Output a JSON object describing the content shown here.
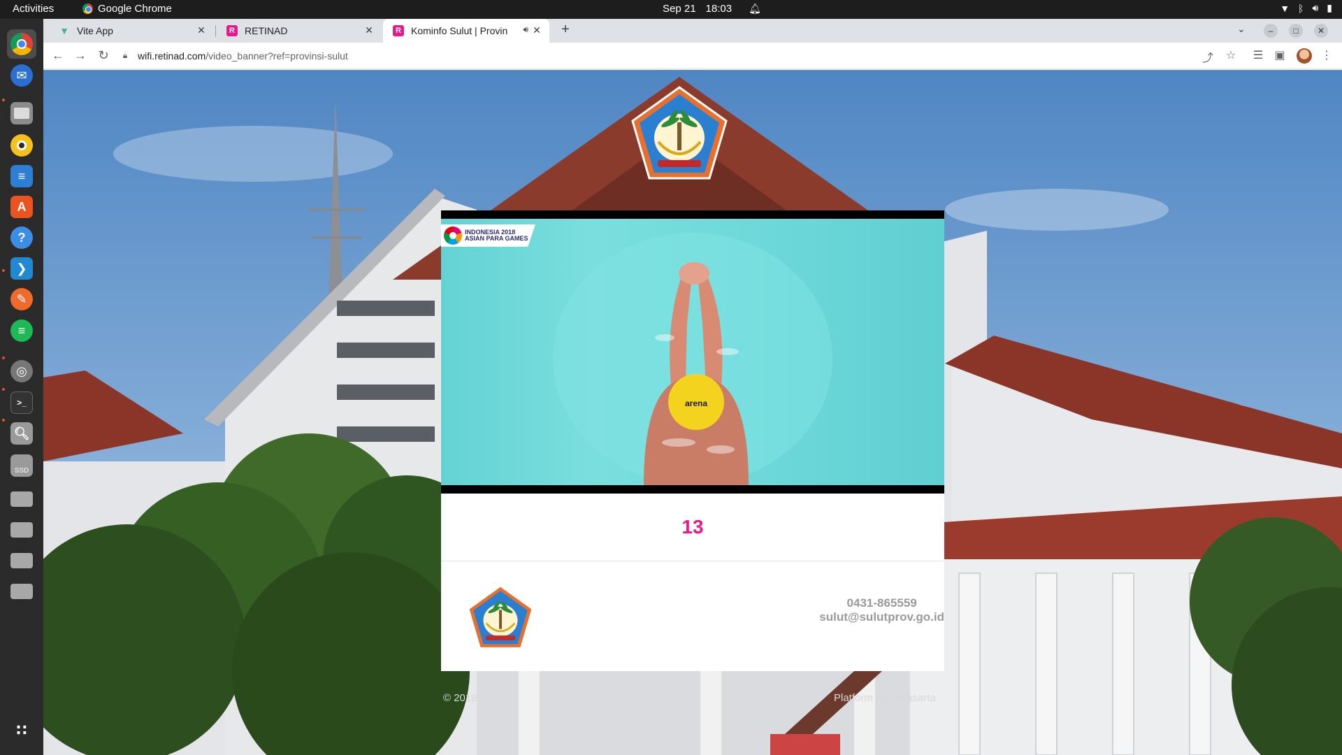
{
  "system": {
    "activities_label": "Activities",
    "app_name": "Google Chrome",
    "date": "Sep 21",
    "time": "18:03"
  },
  "dock": {
    "apps": [
      "chrome-icon",
      "thunderbird-icon",
      "files-icon",
      "rhythmbox-icon",
      "writer-icon",
      "app-center-icon",
      "help-icon",
      "vscode-icon",
      "inkscape-icon",
      "spotify-icon",
      "disk-icon",
      "terminal-icon",
      "image-viewer-icon",
      "ssd-drive-icon",
      "drive-icon",
      "drive-icon",
      "drive-icon",
      "drive-icon",
      "app-grid-icon"
    ],
    "ssd_label": "SSD"
  },
  "browser": {
    "tabs": [
      {
        "title": "Vite App",
        "favicon": "V",
        "color": "#41b883"
      },
      {
        "title": "RETINAD",
        "favicon": "R",
        "color": "#e8198b"
      },
      {
        "title": "Kominfo Sulut | Provin",
        "favicon": "R",
        "color": "#e8198b",
        "active": true
      }
    ],
    "new_tab": "+",
    "url_domain": "wifi.retinad.com",
    "url_path": "/video_banner?ref=provinsi-sulut"
  },
  "page": {
    "video": {
      "badge_line1": "INDONESIA 2018",
      "badge_line2": "ASIAN PARA GAMES",
      "cap_text": "arena"
    },
    "counter": "13",
    "phone": "0431-865559",
    "email": "sulut@sulutprov.go.id",
    "copyright": "© 2018",
    "platform": "Platform by Lintasarta"
  }
}
